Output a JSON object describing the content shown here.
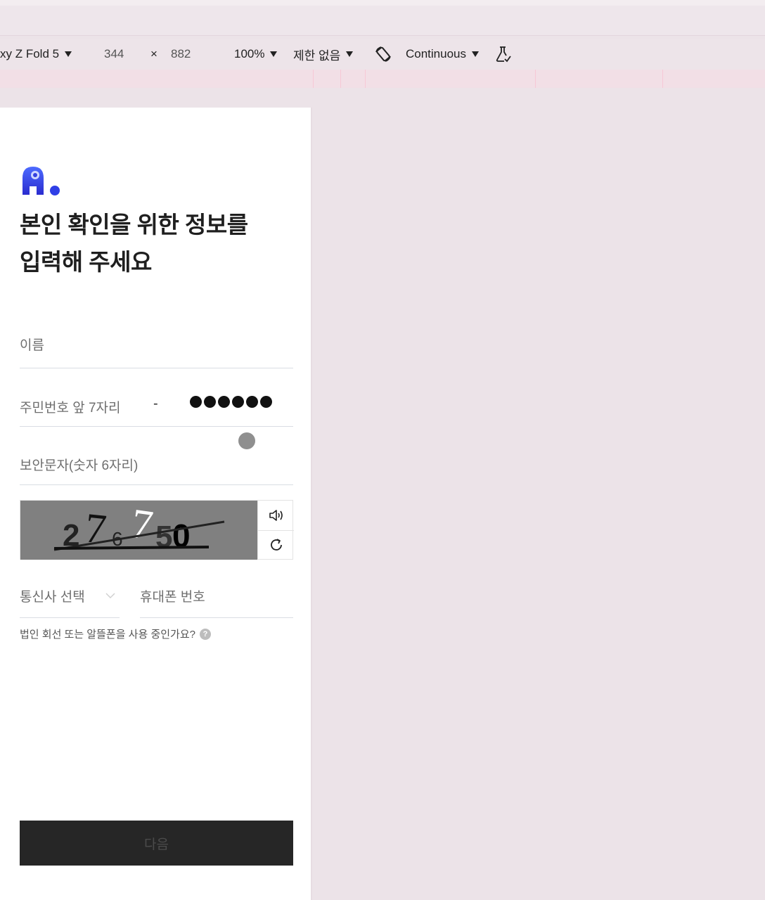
{
  "devtools": {
    "device": "xy Z Fold 5",
    "width": "344",
    "times": "×",
    "height": "882",
    "zoom": "100%",
    "throttle": "제한 없음",
    "mode": "Continuous"
  },
  "page": {
    "heading_line1": "본인 확인을 위한 정보를",
    "heading_line2": "입력해 주세요",
    "name_label": "이름",
    "rrn_label": "주민번호 앞 7자리",
    "rrn_dash": "-",
    "captcha_label": "보안문자(숫자 6자리)",
    "captcha_text": [
      "2",
      "7",
      "6",
      "7",
      "5",
      "0"
    ],
    "carrier_label": "통신사 선택",
    "phone_label": "휴대폰 번호",
    "corp_question": "법인 회선 또는 알뜰폰을 사용 중인가요?",
    "question_mark": "?",
    "next_button": "다음"
  },
  "colors": {
    "button_bg": "#262626",
    "logo_blue": "#2b3fe0",
    "captcha_bg": "#808080"
  },
  "icons": [
    "chevron-down-icon",
    "rotate-icon",
    "flask-icon",
    "speaker-icon",
    "refresh-icon",
    "help-icon"
  ]
}
